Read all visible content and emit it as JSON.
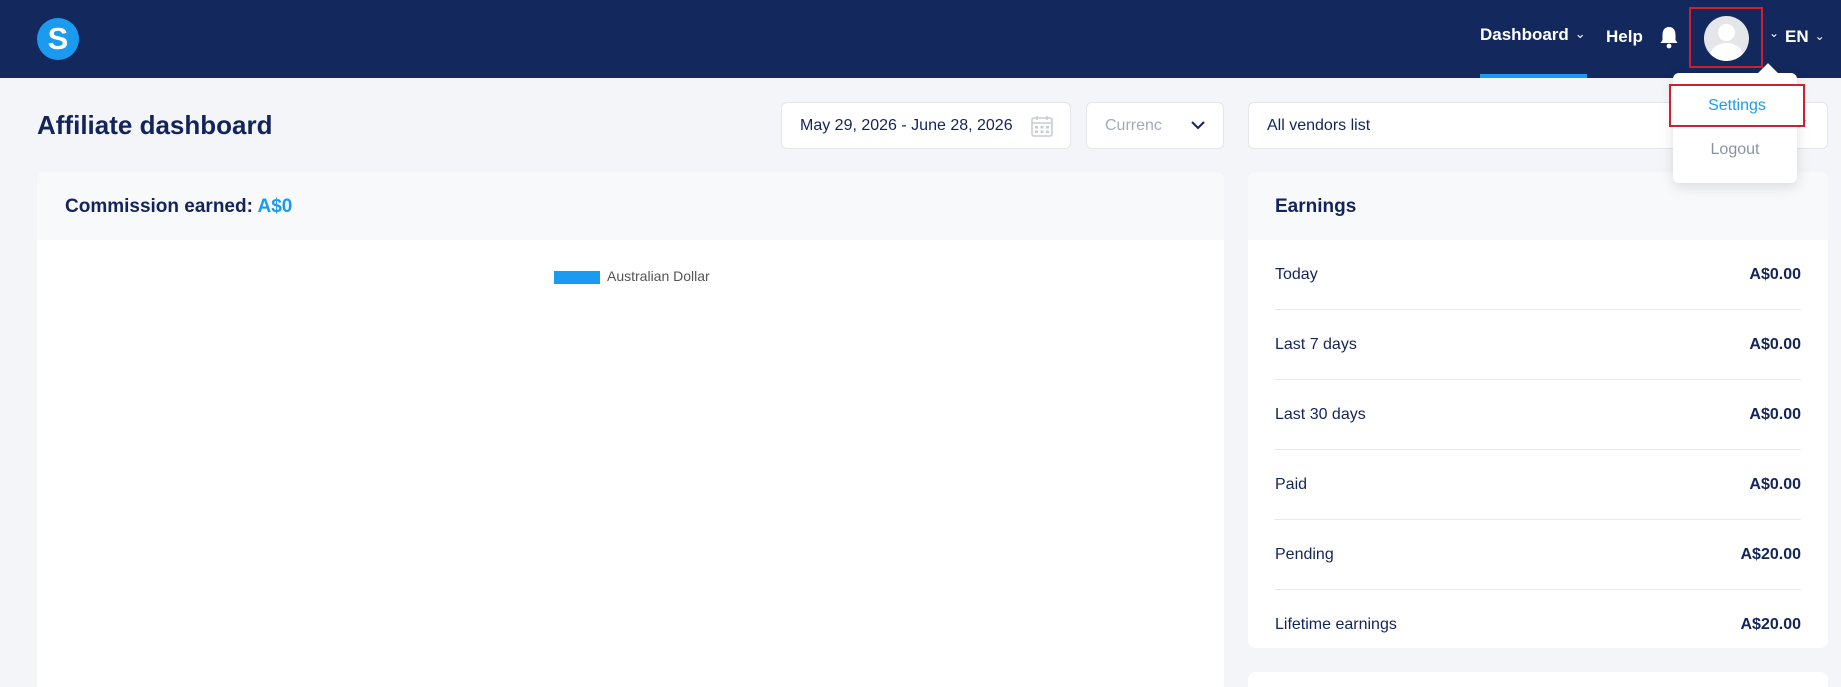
{
  "header": {
    "logo_letter": "S",
    "nav": {
      "dashboard": "Dashboard",
      "help": "Help"
    },
    "language": "EN",
    "icons": [
      "bell-icon",
      "avatar-icon",
      "chevron-down-icon"
    ]
  },
  "user_menu": {
    "items": [
      {
        "label": "Settings"
      },
      {
        "label": "Logout"
      }
    ]
  },
  "page": {
    "title": "Affiliate dashboard"
  },
  "filters": {
    "date_range": "May 29, 2026 - June 28, 2026",
    "currency_placeholder": "Currenc",
    "vendor": "All vendors list"
  },
  "commission": {
    "label": "Commission earned:",
    "amount": "A$0",
    "legend": "Australian Dollar",
    "accent_color": "#1a9bf0"
  },
  "earnings": {
    "title": "Earnings",
    "rows": [
      {
        "label": "Today",
        "value": "A$0.00"
      },
      {
        "label": "Last 7 days",
        "value": "A$0.00"
      },
      {
        "label": "Last 30 days",
        "value": "A$0.00"
      },
      {
        "label": "Paid",
        "value": "A$0.00"
      },
      {
        "label": "Pending",
        "value": "A$20.00"
      },
      {
        "label": "Lifetime earnings",
        "value": "A$20.00"
      }
    ]
  },
  "colors": {
    "navbar": "#13295e",
    "accent": "#1a9bf0",
    "highlight": "#d0202f"
  }
}
